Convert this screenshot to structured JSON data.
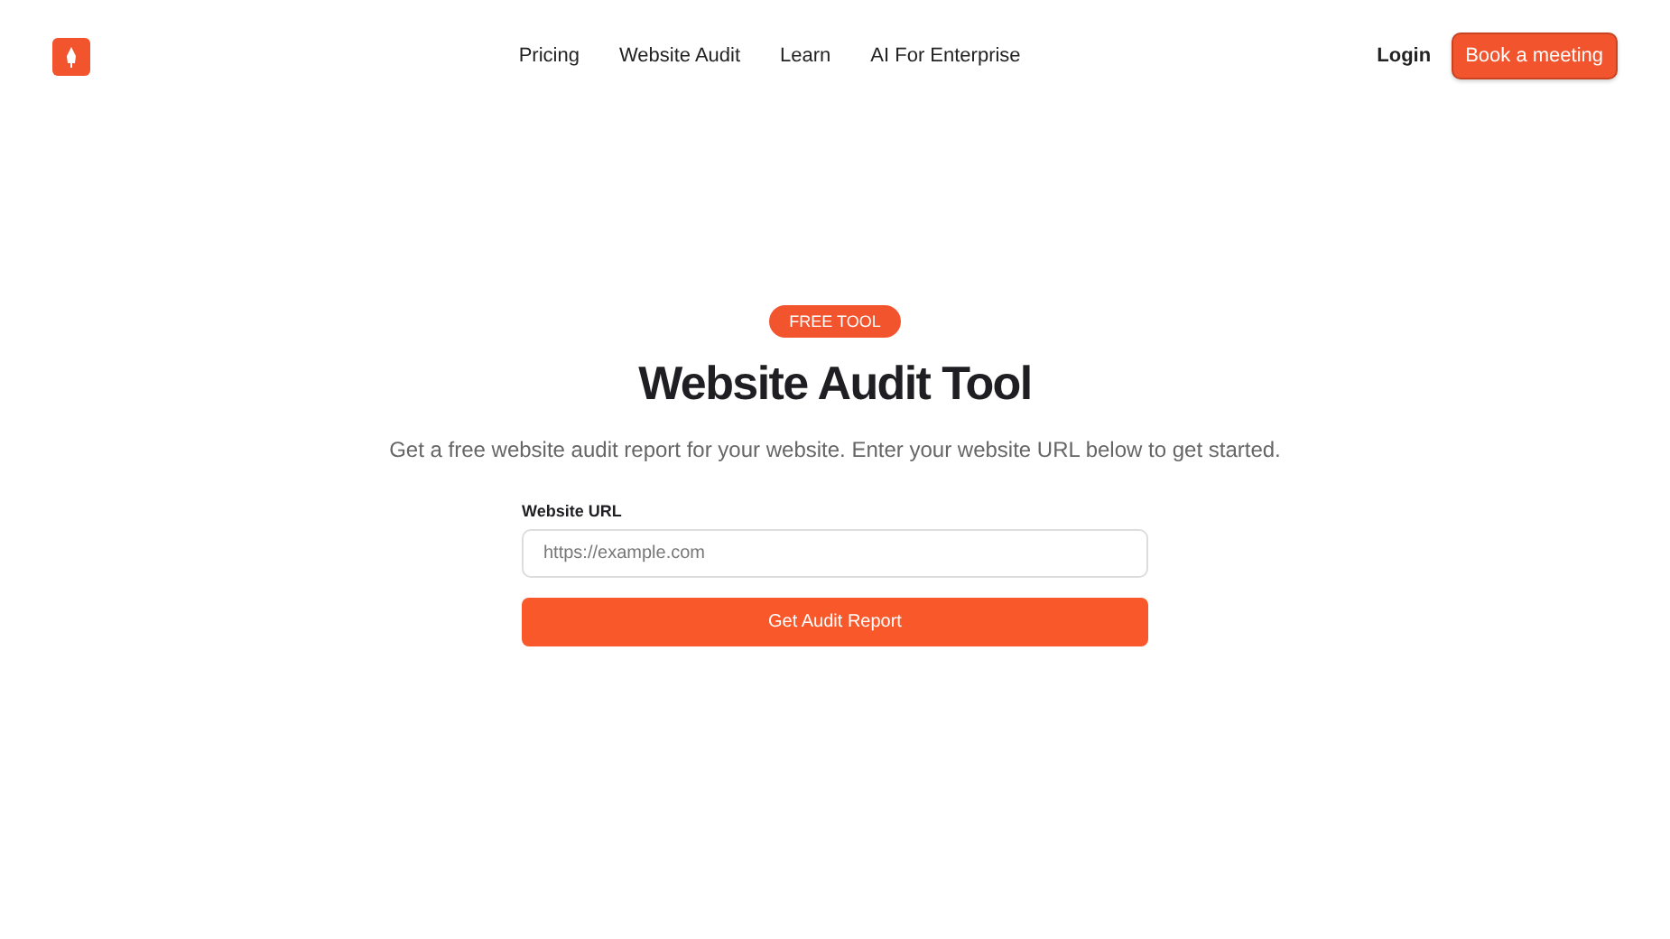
{
  "nav": {
    "links": [
      "Pricing",
      "Website Audit",
      "Learn",
      "AI For Enterprise"
    ],
    "login": "Login",
    "cta": "Book a meeting"
  },
  "hero": {
    "badge": "FREE TOOL",
    "title": "Website Audit Tool",
    "subtitle": "Get a free website audit report for your website. Enter your website URL below to get started.",
    "field": {
      "label": "Website URL",
      "placeholder": "https://example.com"
    },
    "submit": "Get Audit Report"
  }
}
